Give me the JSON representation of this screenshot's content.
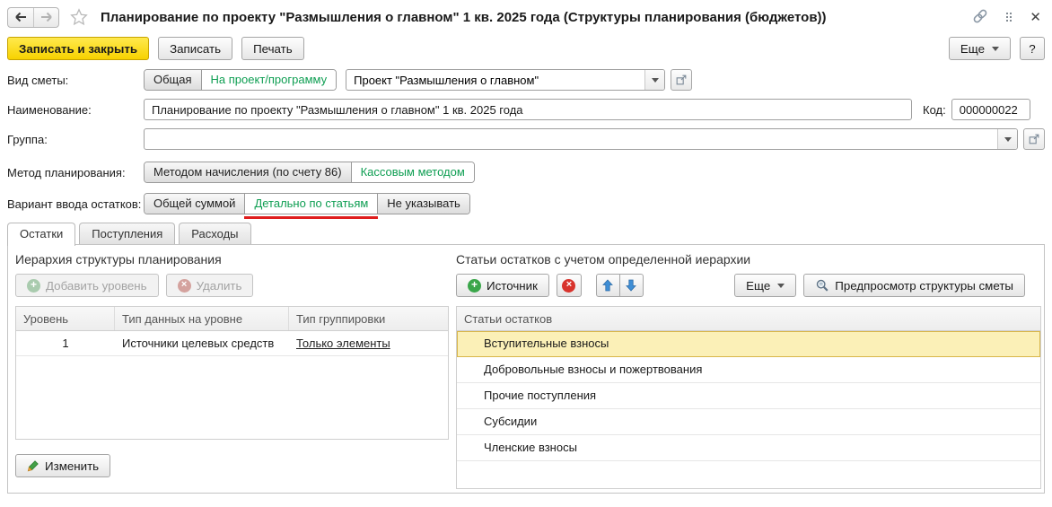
{
  "window": {
    "title": "Планирование по проекту \"Размышления о главном\" 1 кв. 2025 года (Структуры планирования (бюджетов))"
  },
  "icons": {
    "back": "arrow-left",
    "forward": "arrow-right",
    "favorite": "star-outline",
    "link": "chain",
    "more_commands": "vertical-dots",
    "close": "x",
    "dropdown": "caret-down",
    "open_form": "open-in-new",
    "add": "plus-circle-green",
    "delete": "x-circle-red",
    "move_up": "arrow-up-blue",
    "move_down": "arrow-down-blue",
    "edit": "pencil-green",
    "preview": "magnifier"
  },
  "colors": {
    "accent_green": "#0e9e52",
    "save_yellow": "#f7d200",
    "selected_row_bg": "#fbf0b7",
    "selected_row_border": "#d9b64a",
    "red_underline": "#df1d1d",
    "arrow_blue": "#3e8ed6"
  },
  "command_bar": {
    "save_close": "Записать и закрыть",
    "save": "Записать",
    "print": "Печать",
    "more": "Еще",
    "help": "?"
  },
  "form": {
    "vid_smety": {
      "label": "Вид сметы:",
      "options": [
        "Общая",
        "На проект/программу"
      ],
      "selected": "На проект/программу",
      "value": "Проект \"Размышления о главном\""
    },
    "naimenovanie": {
      "label": "Наименование:",
      "value": "Планирование по проекту \"Размышления о главном\" 1 кв. 2025 года"
    },
    "kod": {
      "label": "Код:",
      "value": "000000022"
    },
    "gruppa": {
      "label": "Группа:",
      "value": ""
    },
    "metod": {
      "label": "Метод планирования:",
      "options": [
        "Методом начисления (по счету 86)",
        "Кассовым методом"
      ],
      "selected": "Кассовым методом"
    },
    "variant": {
      "label": "Вариант ввода остатков:",
      "options": [
        "Общей суммой",
        "Детально по статьям",
        "Не указывать"
      ],
      "selected": "Детально по статьям"
    }
  },
  "tabs": [
    {
      "label": "Остатки",
      "active": true
    },
    {
      "label": "Поступления",
      "active": false
    },
    {
      "label": "Расходы",
      "active": false
    }
  ],
  "left_panel": {
    "title": "Иерархия структуры планирования",
    "toolbar": {
      "add": "Добавить уровень",
      "delete": "Удалить"
    },
    "edit_button": "Изменить",
    "table": {
      "headers": [
        "Уровень",
        "Тип данных на уровне",
        "Тип группировки"
      ],
      "rows": [
        {
          "level": "1",
          "data_type": "Источники целевых средств",
          "group_type": "Только элементы"
        }
      ]
    }
  },
  "right_panel": {
    "title": "Статьи остатков с учетом определенной иерархии",
    "toolbar": {
      "source": "Источник",
      "more": "Еще",
      "preview": "Предпросмотр структуры сметы"
    },
    "table": {
      "header": "Статьи остатков",
      "selected_index": 0,
      "rows": [
        "Вступительные взносы",
        "Добровольные взносы и пожертвования",
        "Прочие поступления",
        "Субсидии",
        "Членские взносы"
      ]
    }
  }
}
